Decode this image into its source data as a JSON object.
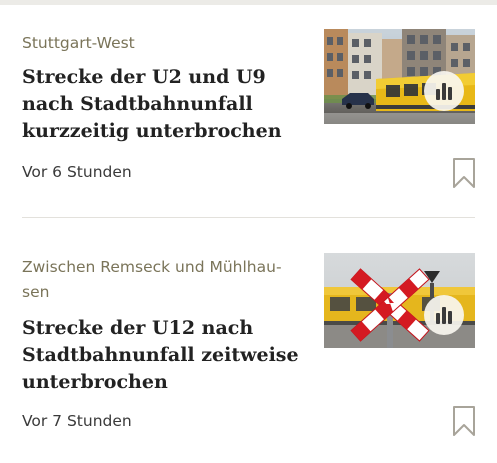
{
  "articles": [
    {
      "kicker": "Stuttgart-West",
      "headline": "Strecke der U2 und U9 nach Stadtbahnunfall kurzzeitig unterbrochen",
      "timestamp": "Vor 6 Stunden"
    },
    {
      "kicker": "Zwischen Remseck und Mühlhau-sen",
      "headline": "Strecke der U12 nach Stadtbahnunfall zeitweise unterbrochen",
      "timestamp": "Vor 7 Stunden"
    }
  ],
  "colors": {
    "kicker": "#7a7459",
    "headline": "#222222",
    "timestamp": "#3a3a3a",
    "divider": "#e3e1dc",
    "bookmark": "#a8a49a"
  },
  "icons": {
    "audio": "audio-bars-icon",
    "bookmark": "bookmark-icon"
  }
}
